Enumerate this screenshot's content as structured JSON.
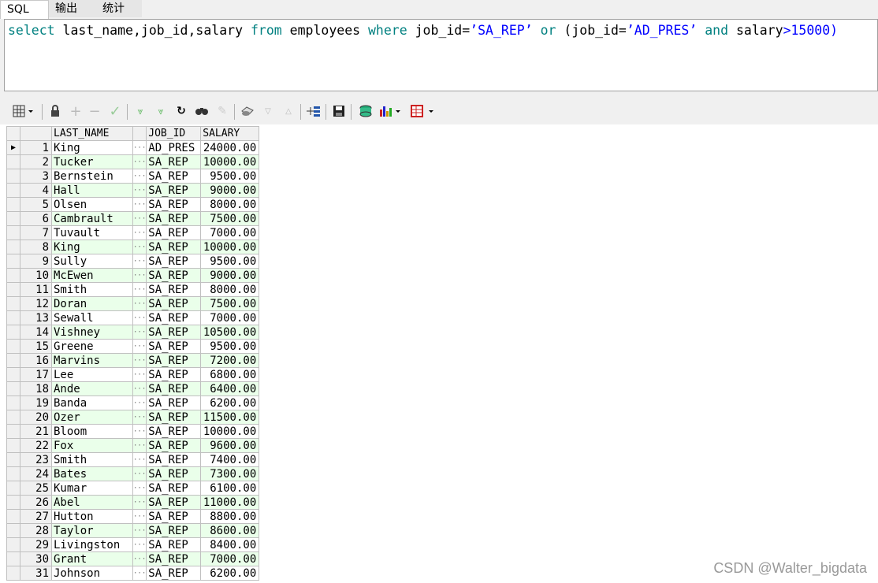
{
  "tabs": [
    {
      "label": "SQL",
      "active": true
    },
    {
      "label": "输出",
      "active": false
    },
    {
      "label": "统计",
      "active": false
    }
  ],
  "sql": {
    "t1": "select",
    "t2": " last_name,job_id,salary ",
    "t3": "from",
    "t4": " employees ",
    "t5": "where",
    "t6": " job_id=",
    "t7": "’SA_REP’",
    "t8": " ",
    "t9": "or",
    "t10": " (job_id=",
    "t11": "’AD_PRES’",
    "t12": " ",
    "t13": "and",
    "t14": " salary",
    "t15": ">",
    "t16": "15000)"
  },
  "toolbar": {
    "icons": [
      "grid-menu-icon",
      "lock-icon",
      "add-record-icon",
      "delete-record-icon",
      "post-icon",
      "query-by-example-icon",
      "filter-icon",
      "refresh-icon",
      "find-icon",
      "clear-icon",
      "export-icon",
      "sort-down-icon",
      "sort-up-icon",
      "explain-plan-icon",
      "save-icon",
      "database-icon",
      "chart-icon",
      "table-icon"
    ]
  },
  "grid": {
    "columns": [
      "LAST_NAME",
      "JOB_ID",
      "SALARY"
    ],
    "rows": [
      {
        "n": "1",
        "last_name": "King",
        "job_id": "AD_PRES",
        "salary": "24000.00"
      },
      {
        "n": "2",
        "last_name": "Tucker",
        "job_id": "SA_REP",
        "salary": "10000.00"
      },
      {
        "n": "3",
        "last_name": "Bernstein",
        "job_id": "SA_REP",
        "salary": "9500.00"
      },
      {
        "n": "4",
        "last_name": "Hall",
        "job_id": "SA_REP",
        "salary": "9000.00"
      },
      {
        "n": "5",
        "last_name": "Olsen",
        "job_id": "SA_REP",
        "salary": "8000.00"
      },
      {
        "n": "6",
        "last_name": "Cambrault",
        "job_id": "SA_REP",
        "salary": "7500.00"
      },
      {
        "n": "7",
        "last_name": "Tuvault",
        "job_id": "SA_REP",
        "salary": "7000.00"
      },
      {
        "n": "8",
        "last_name": "King",
        "job_id": "SA_REP",
        "salary": "10000.00"
      },
      {
        "n": "9",
        "last_name": "Sully",
        "job_id": "SA_REP",
        "salary": "9500.00"
      },
      {
        "n": "10",
        "last_name": "McEwen",
        "job_id": "SA_REP",
        "salary": "9000.00"
      },
      {
        "n": "11",
        "last_name": "Smith",
        "job_id": "SA_REP",
        "salary": "8000.00"
      },
      {
        "n": "12",
        "last_name": "Doran",
        "job_id": "SA_REP",
        "salary": "7500.00"
      },
      {
        "n": "13",
        "last_name": "Sewall",
        "job_id": "SA_REP",
        "salary": "7000.00"
      },
      {
        "n": "14",
        "last_name": "Vishney",
        "job_id": "SA_REP",
        "salary": "10500.00"
      },
      {
        "n": "15",
        "last_name": "Greene",
        "job_id": "SA_REP",
        "salary": "9500.00"
      },
      {
        "n": "16",
        "last_name": "Marvins",
        "job_id": "SA_REP",
        "salary": "7200.00"
      },
      {
        "n": "17",
        "last_name": "Lee",
        "job_id": "SA_REP",
        "salary": "6800.00"
      },
      {
        "n": "18",
        "last_name": "Ande",
        "job_id": "SA_REP",
        "salary": "6400.00"
      },
      {
        "n": "19",
        "last_name": "Banda",
        "job_id": "SA_REP",
        "salary": "6200.00"
      },
      {
        "n": "20",
        "last_name": "Ozer",
        "job_id": "SA_REP",
        "salary": "11500.00"
      },
      {
        "n": "21",
        "last_name": "Bloom",
        "job_id": "SA_REP",
        "salary": "10000.00"
      },
      {
        "n": "22",
        "last_name": "Fox",
        "job_id": "SA_REP",
        "salary": "9600.00"
      },
      {
        "n": "23",
        "last_name": "Smith",
        "job_id": "SA_REP",
        "salary": "7400.00"
      },
      {
        "n": "24",
        "last_name": "Bates",
        "job_id": "SA_REP",
        "salary": "7300.00"
      },
      {
        "n": "25",
        "last_name": "Kumar",
        "job_id": "SA_REP",
        "salary": "6100.00"
      },
      {
        "n": "26",
        "last_name": "Abel",
        "job_id": "SA_REP",
        "salary": "11000.00"
      },
      {
        "n": "27",
        "last_name": "Hutton",
        "job_id": "SA_REP",
        "salary": "8800.00"
      },
      {
        "n": "28",
        "last_name": "Taylor",
        "job_id": "SA_REP",
        "salary": "8600.00"
      },
      {
        "n": "29",
        "last_name": "Livingston",
        "job_id": "SA_REP",
        "salary": "8400.00"
      },
      {
        "n": "30",
        "last_name": "Grant",
        "job_id": "SA_REP",
        "salary": "7000.00"
      },
      {
        "n": "31",
        "last_name": "Johnson",
        "job_id": "SA_REP",
        "salary": "6200.00"
      }
    ]
  },
  "watermark": "CSDN @Walter_bigdata",
  "colors": {
    "keyword": "#008080",
    "string": "#0000ff",
    "row_alt": "#eaffea"
  }
}
